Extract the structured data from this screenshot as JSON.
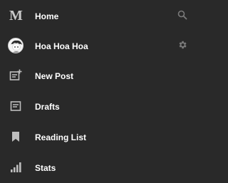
{
  "menu": {
    "items": [
      {
        "label": "Home",
        "icon": "medium-logo-icon",
        "right_icon": "search-icon"
      },
      {
        "label": "Hoa Hoa Hoa",
        "icon": "avatar",
        "right_icon": "gear-icon"
      },
      {
        "label": "New Post",
        "icon": "new-post-icon"
      },
      {
        "label": "Drafts",
        "icon": "drafts-icon"
      },
      {
        "label": "Reading List",
        "icon": "bookmark-icon"
      },
      {
        "label": "Stats",
        "icon": "stats-icon"
      }
    ],
    "logo_letter": "M"
  },
  "colors": {
    "background": "#292929",
    "text": "#ffffff",
    "icon": "#bdbdbd",
    "right_icon": "#7a7a7a"
  }
}
